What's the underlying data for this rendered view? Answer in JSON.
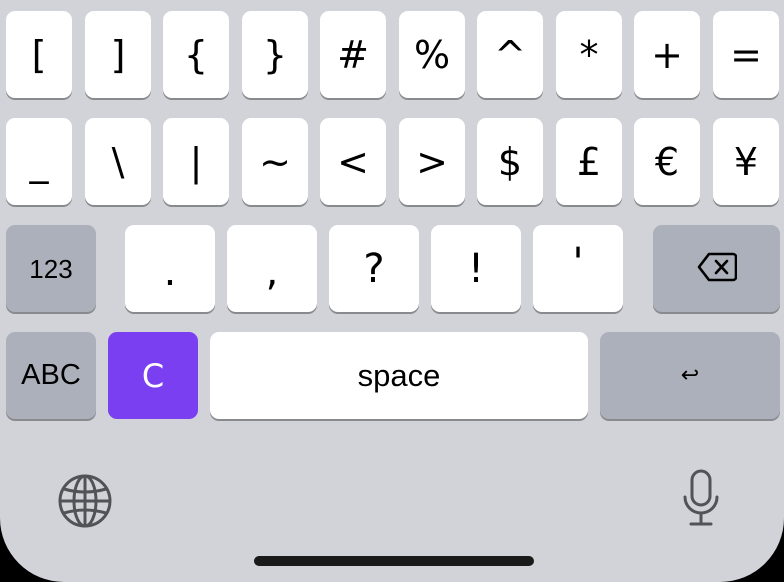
{
  "rows": {
    "symbols1": [
      "[",
      "]",
      "{",
      "}",
      "#",
      "%",
      "^",
      "*",
      "+",
      "="
    ],
    "symbols2": [
      "_",
      "\\",
      "|",
      "~",
      "<",
      ">",
      "$",
      "£",
      "€",
      "¥"
    ],
    "punctuation": [
      ".",
      ",",
      "?",
      "!",
      "'"
    ]
  },
  "keys": {
    "numbers_label": "123",
    "abc_label": "ABC",
    "accent_label": "C",
    "space_label": "space",
    "return_label": "↩"
  },
  "icons": {
    "delete": "backspace-icon",
    "globe": "globe-icon",
    "mic": "microphone-icon"
  },
  "colors": {
    "keyboard_bg": "#d1d3d9",
    "key_bg": "#ffffff",
    "function_key_bg": "#abb0ba",
    "accent": "#7b3ff2"
  }
}
